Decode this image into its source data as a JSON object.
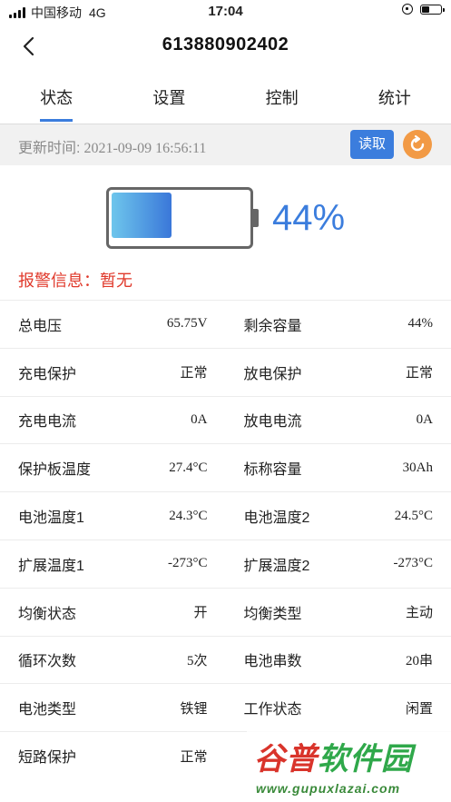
{
  "status_bar": {
    "carrier": "中国移动",
    "network": "4G",
    "time": "17:04"
  },
  "nav": {
    "title": "613880902402"
  },
  "tabs": [
    {
      "label": "状态",
      "active": true
    },
    {
      "label": "设置",
      "active": false
    },
    {
      "label": "控制",
      "active": false
    },
    {
      "label": "统计",
      "active": false
    }
  ],
  "update": {
    "label": "更新时间:",
    "time": "2021-09-09 16:56:11",
    "read_button": "读取"
  },
  "battery": {
    "level": 0.44,
    "percent_text": "44%"
  },
  "alarm": {
    "text": "报警信息：暂无"
  },
  "rows": [
    [
      {
        "k": "总电压",
        "v": "65.75V"
      },
      {
        "k": "剩余容量",
        "v": "44%"
      }
    ],
    [
      {
        "k": "充电保护",
        "v": "正常"
      },
      {
        "k": "放电保护",
        "v": "正常"
      }
    ],
    [
      {
        "k": "充电电流",
        "v": "0A"
      },
      {
        "k": "放电电流",
        "v": "0A"
      }
    ],
    [
      {
        "k": "保护板温度",
        "v": "27.4°C"
      },
      {
        "k": "标称容量",
        "v": "30Ah"
      }
    ],
    [
      {
        "k": "电池温度1",
        "v": "24.3°C"
      },
      {
        "k": "电池温度2",
        "v": "24.5°C"
      }
    ],
    [
      {
        "k": "扩展温度1",
        "v": "-273°C"
      },
      {
        "k": "扩展温度2",
        "v": "-273°C"
      }
    ],
    [
      {
        "k": "均衡状态",
        "v": "开"
      },
      {
        "k": "均衡类型",
        "v": "主动"
      }
    ],
    [
      {
        "k": "循环次数",
        "v": "5次"
      },
      {
        "k": "电池串数",
        "v": "20串"
      }
    ],
    [
      {
        "k": "电池类型",
        "v": "铁锂"
      },
      {
        "k": "工作状态",
        "v": "闲置"
      }
    ],
    [
      {
        "k": "短路保护",
        "v": "正常"
      },
      {
        "k": "",
        "v": ""
      }
    ]
  ],
  "watermark": {
    "brand_a": "谷普",
    "brand_b": "软件园",
    "url": "www.gupuxlazai.com"
  },
  "colors": {
    "accent": "#3b7ddd",
    "alarm": "#e0392b",
    "refresh": "#f29a45"
  },
  "icons": {
    "back": "chevron-left-icon",
    "refresh": "refresh-icon"
  }
}
